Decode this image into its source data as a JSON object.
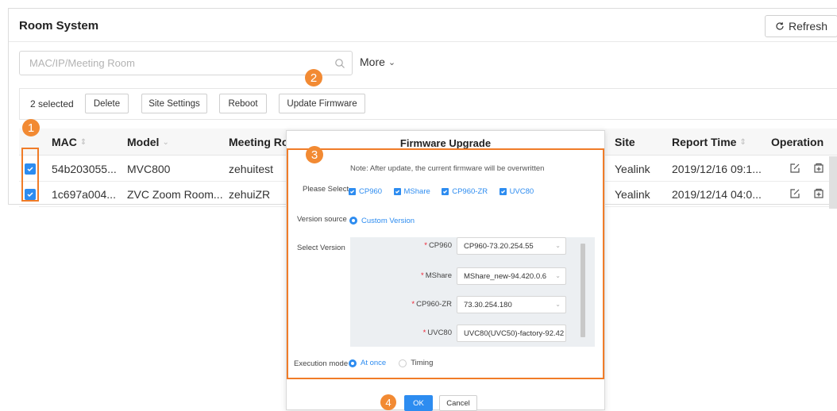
{
  "header": {
    "title": "Room System",
    "refresh_label": "Refresh"
  },
  "search": {
    "placeholder": "MAC/IP/Meeting Room",
    "more_label": "More"
  },
  "toolbar": {
    "selected_text": "2 selected",
    "delete_label": "Delete",
    "site_settings_label": "Site Settings",
    "reboot_label": "Reboot",
    "update_firmware_label": "Update Firmware"
  },
  "table": {
    "columns": {
      "mac": "MAC",
      "model": "Model",
      "meeting_room": "Meeting Roc",
      "site": "Site",
      "report_time": "Report Time",
      "operation": "Operation"
    },
    "rows": [
      {
        "mac": "54b203055...",
        "model": "MVC800",
        "meeting_room": "zehuitest",
        "site": "Yealink",
        "report_time": "2019/12/16 09:1..."
      },
      {
        "mac": "1c697a004...",
        "model": "ZVC Zoom Room...",
        "meeting_room": "zehuiZR",
        "site": "Yealink",
        "report_time": "2019/12/14 04:0..."
      }
    ]
  },
  "badges": [
    "1",
    "2",
    "3",
    "4"
  ],
  "modal": {
    "title": "Firmware Upgrade",
    "note": "Note: After update, the current firmware will be overwritten",
    "please_select_label": "Please Select",
    "devices": [
      "CP960",
      "MShare",
      "CP960-ZR",
      "UVC80"
    ],
    "version_source_label": "Version source",
    "version_source_value": "Custom Version",
    "select_version_label": "Select Version",
    "versions": [
      {
        "label": "CP960",
        "value": "CP960-73.20.254.55"
      },
      {
        "label": "MShare",
        "value": "MShare_new-94.420.0.6"
      },
      {
        "label": "CP960-ZR",
        "value": "73.30.254.180"
      },
      {
        "label": "UVC80",
        "value": "UVC80(UVC50)-factory-92.42"
      }
    ],
    "execution_mode_label": "Execution mode",
    "execution_options": [
      "At once",
      "Timing"
    ],
    "ok_label": "OK",
    "cancel_label": "Cancel"
  },
  "colors": {
    "accent": "#2d8cf0",
    "highlight": "#f07c28"
  }
}
